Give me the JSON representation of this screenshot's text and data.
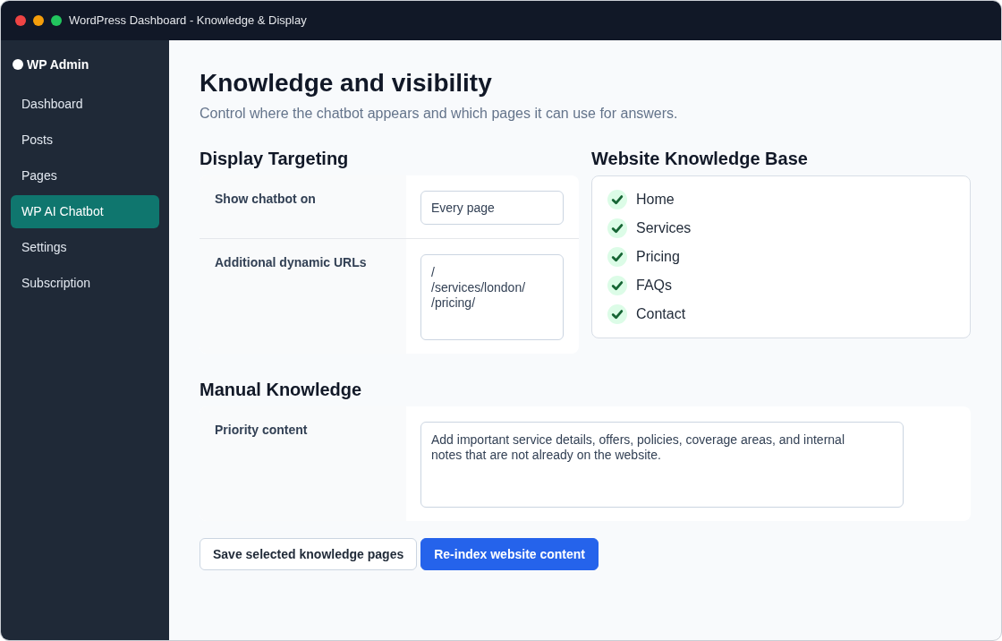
{
  "window": {
    "title": "WordPress Dashboard - Knowledge & Display"
  },
  "sidebar": {
    "brand": "WP Admin",
    "items": [
      {
        "label": "Dashboard",
        "selected": false
      },
      {
        "label": "Posts",
        "selected": false
      },
      {
        "label": "Pages",
        "selected": false
      },
      {
        "label": "WP AI Chatbot",
        "selected": true
      },
      {
        "label": "Settings",
        "selected": false
      },
      {
        "label": "Subscription",
        "selected": false
      }
    ]
  },
  "page": {
    "title": "Knowledge and visibility",
    "subtitle": "Control where the chatbot appears and which pages it can use for answers."
  },
  "display_targeting": {
    "heading": "Display Targeting",
    "rows": [
      {
        "label": "Show chatbot on",
        "kind": "input",
        "value": "Every page"
      },
      {
        "label": "Additional dynamic URLs",
        "kind": "textarea",
        "value": "/\n/services/london/\n/pricing/"
      }
    ]
  },
  "knowledge_base": {
    "heading": "Website Knowledge Base",
    "pages": [
      {
        "label": "Home",
        "checked": true
      },
      {
        "label": "Services",
        "checked": true
      },
      {
        "label": "Pricing",
        "checked": true
      },
      {
        "label": "FAQs",
        "checked": true
      },
      {
        "label": "Contact",
        "checked": true
      }
    ]
  },
  "manual_knowledge": {
    "heading": "Manual Knowledge",
    "rows": [
      {
        "label": "Priority content",
        "kind": "textarea",
        "value": "Add important service details, offers, policies, coverage areas, and internal notes that are not already on the website."
      }
    ]
  },
  "buttons": [
    {
      "label": "Save selected knowledge pages",
      "kind": "outline"
    },
    {
      "label": "Re-index website content",
      "kind": "primary"
    }
  ]
}
